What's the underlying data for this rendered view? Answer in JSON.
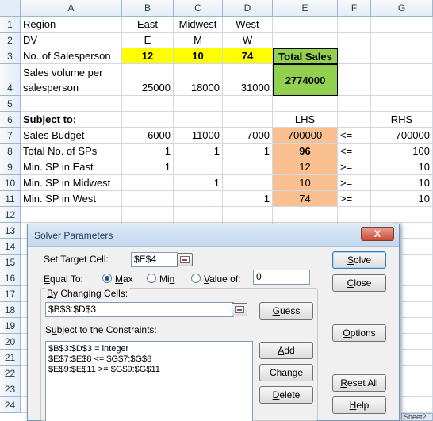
{
  "columns": [
    "A",
    "B",
    "C",
    "D",
    "E",
    "F",
    "G"
  ],
  "rows": [
    "1",
    "2",
    "3",
    "4",
    "5",
    "6",
    "7",
    "8",
    "9",
    "10",
    "11",
    "12",
    "13",
    "14",
    "15",
    "16",
    "17",
    "18",
    "19",
    "20",
    "21",
    "22",
    "23",
    "24"
  ],
  "cells": {
    "A1": "Region",
    "B1": "East",
    "C1": "Midwest",
    "D1": "West",
    "A2": "DV",
    "B2": "E",
    "C2": "M",
    "D2": "W",
    "A3": "No. of Salesperson",
    "B3": "12",
    "C3": "10",
    "D3": "74",
    "E3": "Total Sales",
    "A4a": "Sales volume per",
    "A4b": "salesperson",
    "B4": "25000",
    "C4": "18000",
    "D4": "31000",
    "E4": "2774000",
    "A6": "Subject to:",
    "E6": "LHS",
    "G6": "RHS",
    "A7": "Sales Budget",
    "B7": "6000",
    "C7": "11000",
    "D7": "7000",
    "E7": "700000",
    "F7": "<=",
    "G7": "700000",
    "A8": "Total No. of SPs",
    "B8": "1",
    "C8": "1",
    "D8": "1",
    "E8": "96",
    "F8": "<=",
    "G8": "100",
    "A9": "Min. SP in East",
    "B9": "1",
    "E9": "12",
    "F9": ">=",
    "G9": "10",
    "A10": "Min. SP in Midwest",
    "C10": "1",
    "E10": "10",
    "F10": ">=",
    "G10": "10",
    "A11": "Min. SP in West",
    "D11": "1",
    "E11": "74",
    "F11": ">=",
    "G11": "10"
  },
  "colors": {
    "decision_fill": "#ffff00",
    "objective_fill": "#92d050",
    "lhs_fill": "#fac090"
  },
  "dialog": {
    "title": "Solver Parameters",
    "close_label": "X",
    "set_target_label": "Set Target Cell:",
    "target_cell": "$E$4",
    "equal_to_label": "Equal To:",
    "opt_max": "Max",
    "opt_min": "Min",
    "opt_value": "Value of:",
    "value_of": "0",
    "selected": "Max",
    "changing_cells_label": "By Changing Cells:",
    "changing_cells": "$B$3:$D$3",
    "constraints_label": "Subject to the Constraints:",
    "constraints": [
      "$B$3:$D$3 = integer",
      "$E$7:$E$8 <= $G$7:$G$8",
      "$E$9:$E$11 >= $G$9:$G$11"
    ],
    "buttons": {
      "solve": "Solve",
      "close": "Close",
      "guess": "Guess",
      "options": "Options",
      "add": "Add",
      "change": "Change",
      "delete": "Delete",
      "reset_all": "Reset All",
      "help": "Help"
    }
  },
  "sheet_tab": "Sheet2"
}
